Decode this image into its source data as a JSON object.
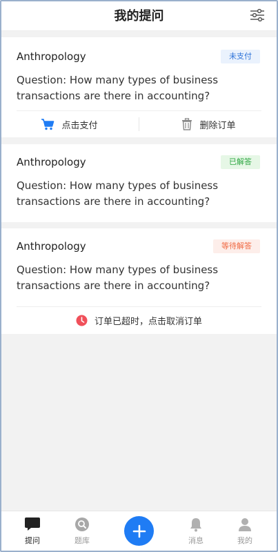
{
  "header": {
    "title": "我的提问",
    "filter_icon": "sliders-icon"
  },
  "orders": [
    {
      "subject": "Anthropology",
      "status": "未支付",
      "question": "Question: How many types of business transactions are there in accounting?",
      "actions": [
        "点击支付",
        "删除订单"
      ]
    },
    {
      "subject": "Anthropology",
      "status": "已解答",
      "question": "Question: How many types of business transactions are there in accounting?"
    },
    {
      "subject": "Anthropology",
      "status": "等待解答",
      "question": "Question: How many types of business transactions are there in accounting?",
      "notice": "订单已超时，点击取消订单"
    }
  ],
  "tabbar": {
    "items": [
      {
        "label": "提问",
        "icon": "chat-bubble-icon",
        "active": true
      },
      {
        "label": "题库",
        "icon": "search-icon",
        "active": false
      },
      {
        "label": "",
        "icon": "plus-icon",
        "active": false
      },
      {
        "label": "消息",
        "icon": "bell-icon",
        "active": false
      },
      {
        "label": "我的",
        "icon": "person-icon",
        "active": false
      }
    ]
  },
  "colors": {
    "accent": "#1f7cf4",
    "unpaid_text": "#2f74d9",
    "answered_text": "#31a845",
    "waiting_text": "#f06a44",
    "timeout_icon": "#f0505a"
  }
}
